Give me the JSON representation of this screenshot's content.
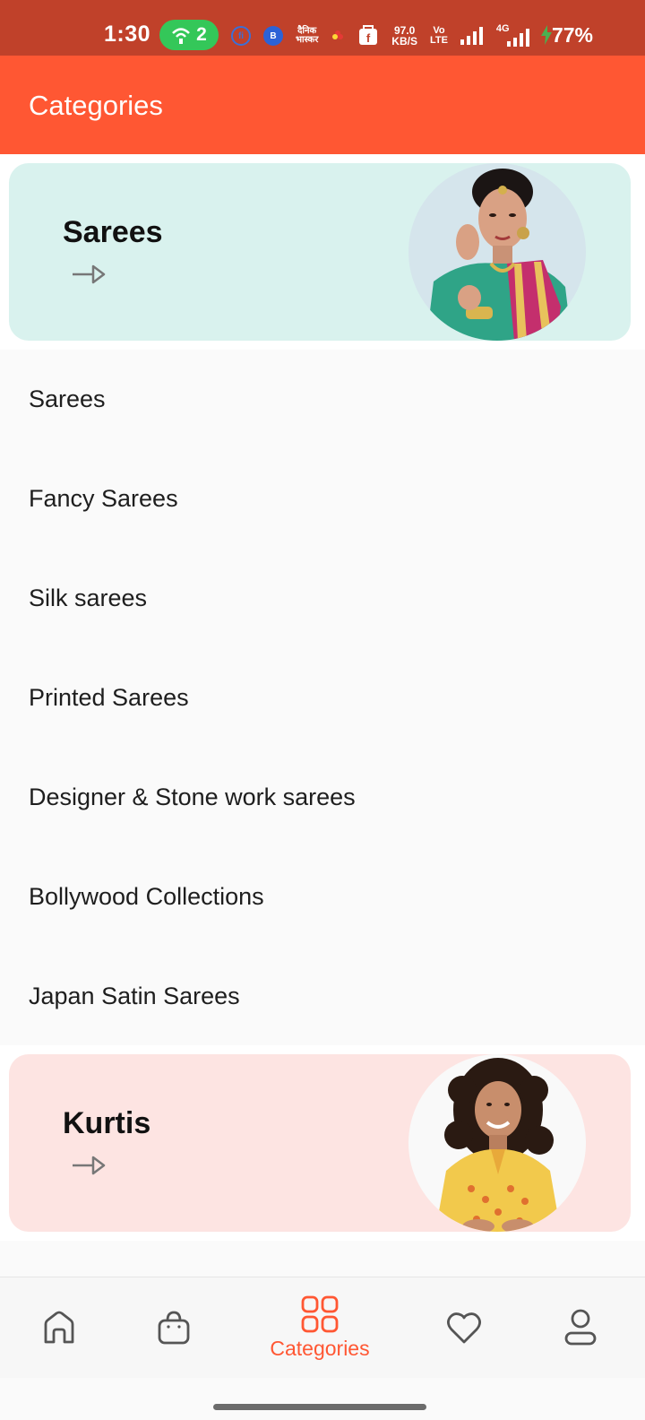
{
  "status_bar": {
    "time": "1:30",
    "hotspot_count": "2",
    "net_speed_value": "97.0",
    "net_speed_unit": "KB/S",
    "volte_top": "Vo",
    "volte_bottom": "LTE",
    "network": "4G",
    "battery": "77%",
    "notification_icons": [
      "fi-icon",
      "b-icon",
      "dainik-bhaskar-icon",
      "flower-icon",
      "flipkart-icon"
    ]
  },
  "app_bar": {
    "title": "Categories"
  },
  "banners": [
    {
      "title": "Sarees",
      "background": "#d9f2ee"
    },
    {
      "title": "Kurtis",
      "background": "#fde4e2"
    }
  ],
  "subcategories": [
    "Sarees",
    "Fancy Sarees",
    "Silk sarees",
    "Printed Sarees",
    "Designer & Stone work sarees",
    "Bollywood Collections",
    "Japan Satin Sarees"
  ],
  "bottom_nav": {
    "items": [
      {
        "icon": "home-icon",
        "label": ""
      },
      {
        "icon": "shopping-bag-icon",
        "label": ""
      },
      {
        "icon": "categories-grid-icon",
        "label": "Categories",
        "active": true
      },
      {
        "icon": "heart-icon",
        "label": ""
      },
      {
        "icon": "profile-icon",
        "label": ""
      }
    ]
  },
  "colors": {
    "accent": "#ff5733",
    "status_bar": "#c0412a",
    "nav_inactive": "#555555"
  }
}
